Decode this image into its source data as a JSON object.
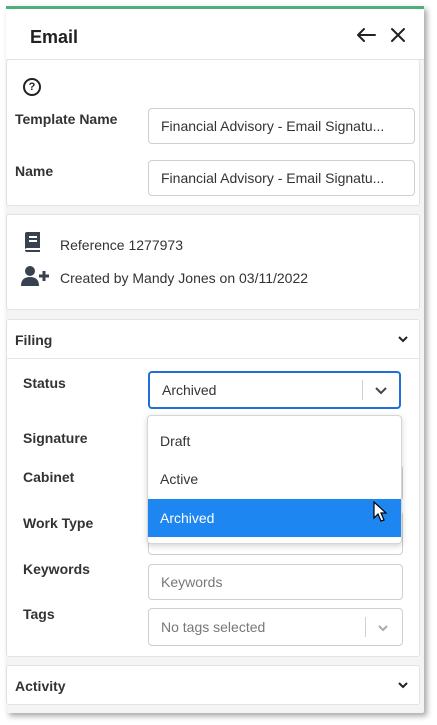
{
  "header": {
    "title": "Email"
  },
  "details": {
    "template_name_label": "Template Name",
    "template_name_value": "Financial Advisory - Email Signatu...",
    "name_label": "Name",
    "name_value": "Financial Advisory - Email Signatu..."
  },
  "info": {
    "reference": "Reference 1277973",
    "created": "Created by Mandy Jones on 03/11/2022"
  },
  "filing": {
    "title": "Filing",
    "status_label": "Status",
    "status_value": "Archived",
    "signature_label": "Signature",
    "cabinet_label": "Cabinet",
    "work_type_label": "Work Type",
    "keywords_label": "Keywords",
    "keywords_placeholder": "Keywords",
    "tags_label": "Tags",
    "tags_placeholder": "No tags selected",
    "status_options": [
      "Draft",
      "Active",
      "Archived"
    ],
    "selected_option": "Archived"
  },
  "activity": {
    "title": "Activity"
  },
  "colors": {
    "accent": "#4caf7c",
    "selected": "#1e86f0",
    "focus": "#1e6fd9"
  }
}
